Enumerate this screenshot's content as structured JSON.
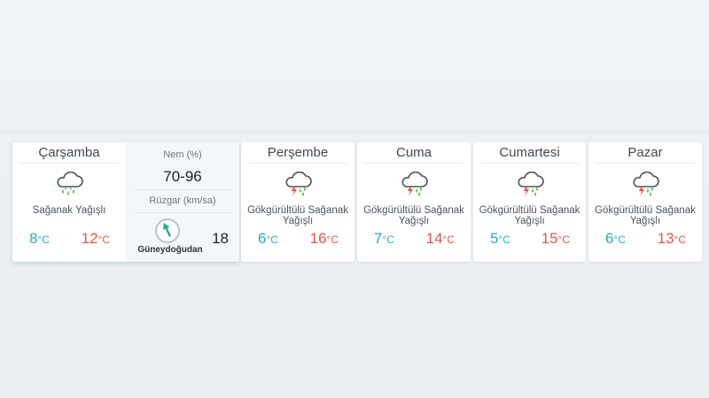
{
  "today": {
    "day": "Çarşamba",
    "icon": "rain-cloud-icon",
    "condition": "Sağanak Yağışlı",
    "min": "8",
    "max": "12",
    "unit": "°C",
    "humidity_label": "Nem (%)",
    "humidity": "70-96",
    "wind_label": "Rüzgar (km/sa)",
    "wind_speed": "18",
    "wind_direction": "Güneydoğudan"
  },
  "days": [
    {
      "day": "Perşembe",
      "icon": "thunder-rain-cloud-icon",
      "condition": "Gökgürültülü Sağanak Yağışlı",
      "min": "6",
      "max": "16",
      "unit": "°C"
    },
    {
      "day": "Cuma",
      "icon": "thunder-rain-cloud-icon",
      "condition": "Gökgürültülü Sağanak Yağışlı",
      "min": "7",
      "max": "14",
      "unit": "°C"
    },
    {
      "day": "Cumartesi",
      "icon": "thunder-rain-cloud-icon",
      "condition": "Gökgürültülü Sağanak Yağışlı",
      "min": "5",
      "max": "15",
      "unit": "°C"
    },
    {
      "day": "Pazar",
      "icon": "thunder-rain-cloud-icon",
      "condition": "Gökgürültülü Sağanak Yağışlı",
      "min": "6",
      "max": "13",
      "unit": "°C"
    }
  ],
  "colors": {
    "min_temp": "#2aa7c9",
    "max_temp": "#e5534b",
    "rain_drop": "#5cc24a",
    "lightning": "#e5534b",
    "cloud_stroke": "#4b555e",
    "wind_arrow": "#2aa79a"
  }
}
